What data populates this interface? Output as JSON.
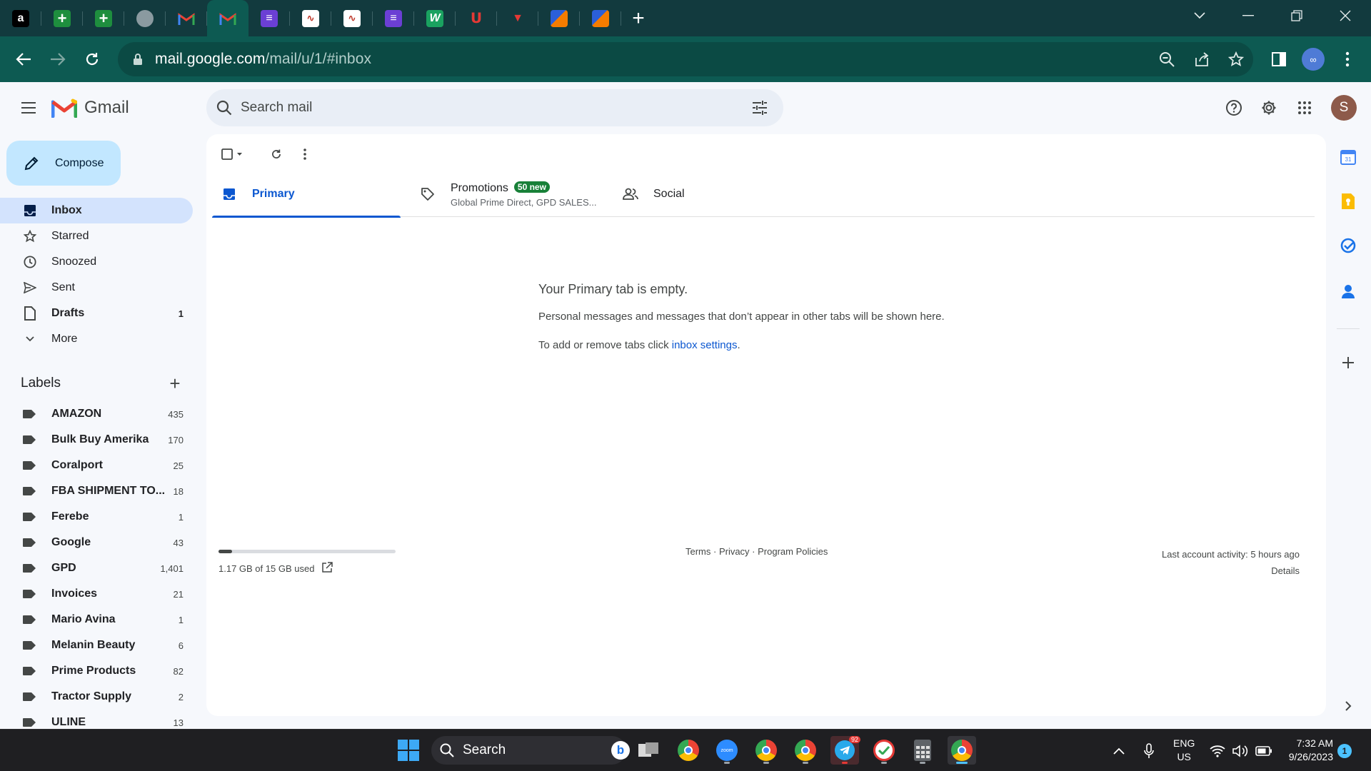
{
  "browser": {
    "tabs": [
      {
        "icon": "amazon-icon",
        "color": "#000000",
        "glyph": "a"
      },
      {
        "icon": "google-sheets-icon",
        "color": "#1e8e3e",
        "glyph": "+"
      },
      {
        "icon": "google-sheets-icon",
        "color": "#1e8e3e",
        "glyph": "+"
      },
      {
        "icon": "globe-icon",
        "color": "#5f6368",
        "glyph": "◍"
      },
      {
        "icon": "gmail-icon",
        "color": "#ffffff",
        "glyph": "M"
      },
      {
        "icon": "gmail-icon",
        "color": "#ffffff",
        "glyph": "M"
      },
      {
        "icon": "list-app-icon",
        "color": "#6b3fd4",
        "glyph": "≡"
      },
      {
        "icon": "chart-app-icon",
        "color": "#ffffff",
        "glyph": "∿"
      },
      {
        "icon": "chart-app-icon",
        "color": "#ffffff",
        "glyph": "∿"
      },
      {
        "icon": "list-app-icon",
        "color": "#6b3fd4",
        "glyph": "≡"
      },
      {
        "icon": "w-app-icon",
        "color": "#1aa260",
        "glyph": "W"
      },
      {
        "icon": "red-logo-icon",
        "color": "#222222",
        "glyph": "Ⴎ"
      },
      {
        "icon": "red-banner-icon",
        "color": "#222222",
        "glyph": "▼"
      },
      {
        "icon": "stripes-app-icon",
        "color": "#2b5fd9",
        "glyph": "/"
      },
      {
        "icon": "stripes-app-icon",
        "color": "#2b5fd9",
        "glyph": "/"
      }
    ],
    "url_host": "mail.google.com",
    "url_path": "/mail/u/1/#inbox"
  },
  "gmail": {
    "product_name": "Gmail",
    "search_placeholder": "Search mail",
    "avatar_letter": "S",
    "compose_label": "Compose",
    "nav": [
      {
        "key": "inbox",
        "label": "Inbox",
        "count": "",
        "bold": true,
        "active": true,
        "icon": "inbox-icon"
      },
      {
        "key": "starred",
        "label": "Starred",
        "count": "",
        "bold": false,
        "active": false,
        "icon": "star-icon"
      },
      {
        "key": "snoozed",
        "label": "Snoozed",
        "count": "",
        "bold": false,
        "active": false,
        "icon": "clock-icon"
      },
      {
        "key": "sent",
        "label": "Sent",
        "count": "",
        "bold": false,
        "active": false,
        "icon": "send-icon"
      },
      {
        "key": "drafts",
        "label": "Drafts",
        "count": "1",
        "bold": true,
        "active": false,
        "icon": "draft-icon"
      },
      {
        "key": "more",
        "label": "More",
        "count": "",
        "bold": false,
        "active": false,
        "icon": "chevron-down-icon"
      }
    ],
    "labels_title": "Labels",
    "labels": [
      {
        "name": "AMAZON",
        "count": "435"
      },
      {
        "name": "Bulk Buy Amerika",
        "count": "170"
      },
      {
        "name": "Coralport",
        "count": "25"
      },
      {
        "name": "FBA SHIPMENT TO...",
        "count": "18"
      },
      {
        "name": "Ferebe",
        "count": "1"
      },
      {
        "name": "Google",
        "count": "43"
      },
      {
        "name": "GPD",
        "count": "1,401"
      },
      {
        "name": "Invoices",
        "count": "21"
      },
      {
        "name": "Mario Avina",
        "count": "1"
      },
      {
        "name": "Melanin Beauty",
        "count": "6"
      },
      {
        "name": "Prime Products",
        "count": "82"
      },
      {
        "name": "Tractor Supply",
        "count": "2"
      },
      {
        "name": "ULINE",
        "count": "13"
      }
    ],
    "tabs": {
      "primary": "Primary",
      "promotions": "Promotions",
      "promotions_badge": "50 new",
      "promotions_senders": "Global Prime Direct, GPD SALES...",
      "social": "Social"
    },
    "empty_state": {
      "title": "Your Primary tab is empty.",
      "description": "Personal messages and messages that don’t appear in other tabs will be shown here.",
      "settings_prefix": "To add or remove tabs click ",
      "settings_link": "inbox settings",
      "settings_suffix": "."
    },
    "storage": {
      "used_text": "1.17 GB of 15 GB used",
      "used_fraction": 0.078
    },
    "footer": {
      "links_text": "Terms · Privacy · Program Policies",
      "last_activity": "Last account activity: 5 hours ago",
      "details": "Details"
    }
  },
  "taskbar": {
    "search_label": "Search",
    "apps": [
      {
        "icon": "task-view-icon"
      },
      {
        "icon": "chrome-icon"
      },
      {
        "icon": "zoom-icon"
      },
      {
        "icon": "chrome-profile-icon"
      },
      {
        "icon": "chrome-profile-d-icon"
      },
      {
        "icon": "telegram-icon",
        "badge": "92"
      },
      {
        "icon": "checkmark-app-icon"
      },
      {
        "icon": "calculator-icon"
      },
      {
        "icon": "chrome-active-icon"
      }
    ],
    "lang_top": "ENG",
    "lang_bottom": "US",
    "time": "7:32 AM",
    "date": "9/26/2023",
    "notification_count": "1"
  }
}
